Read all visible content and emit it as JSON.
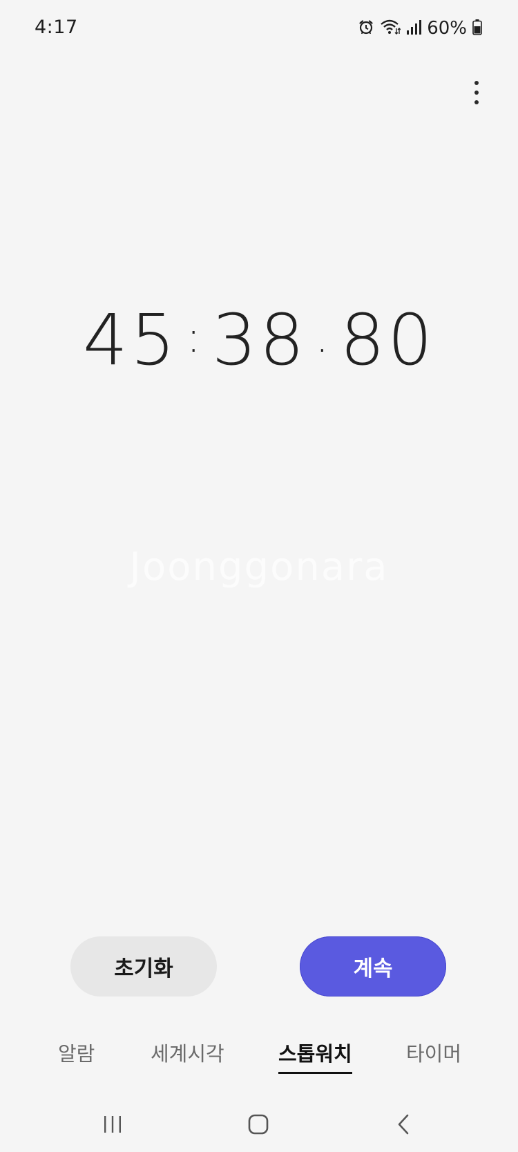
{
  "status_bar": {
    "time": "4:17",
    "battery_percent": "60%",
    "icons": [
      "alarm-icon",
      "wifi-icon",
      "signal-icon",
      "battery-icon"
    ]
  },
  "stopwatch": {
    "minutes": "45",
    "seconds": "38",
    "centiseconds": "80",
    "minute_separator": ":",
    "second_separator": "."
  },
  "watermark": "Joonggonara",
  "buttons": {
    "reset_label": "초기화",
    "resume_label": "계속"
  },
  "tabs": [
    {
      "label": "알람",
      "active": false
    },
    {
      "label": "세계시각",
      "active": false
    },
    {
      "label": "스톱워치",
      "active": true
    },
    {
      "label": "타이머",
      "active": false
    }
  ],
  "colors": {
    "background": "#f5f5f5",
    "resume_button": "#5a5ae0",
    "reset_button": "#e7e7e7",
    "active_tab": "#111111",
    "inactive_tab": "#6a6a6a"
  },
  "nav_bar": {
    "icons": [
      "recent-apps-icon",
      "home-icon",
      "back-icon"
    ]
  }
}
